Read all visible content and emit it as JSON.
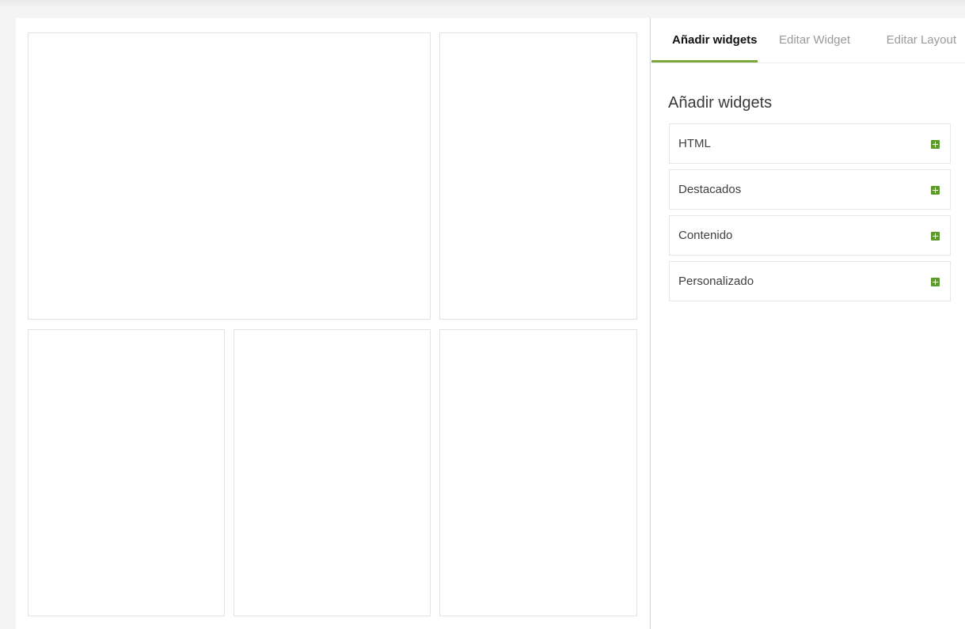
{
  "tabs": {
    "add_widgets": "Añadir widgets",
    "edit_widget": "Editar Widget",
    "edit_layout": "Editar Layout",
    "active": "add_widgets"
  },
  "panel": {
    "title": "Añadir widgets",
    "widgets": [
      {
        "label": "HTML",
        "icon": "plus-icon"
      },
      {
        "label": "Destacados",
        "icon": "plus-icon"
      },
      {
        "label": "Contenido",
        "icon": "plus-icon"
      },
      {
        "label": "Personalizado",
        "icon": "plus-icon"
      }
    ]
  },
  "colors": {
    "accent": "#7aa63c",
    "plus_icon": "#5c9a2c",
    "background": "#f4f4f4"
  }
}
